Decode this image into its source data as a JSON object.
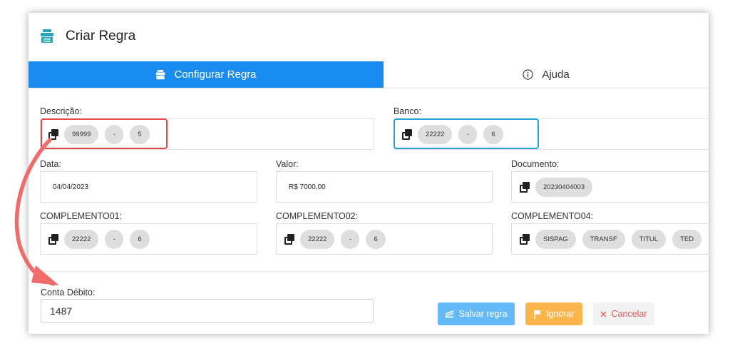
{
  "header": {
    "title": "Criar Regra"
  },
  "tabs": [
    {
      "label": "Configurar Regra",
      "active": true
    },
    {
      "label": "Ajuda",
      "active": false
    }
  ],
  "fields": {
    "descricao": {
      "label": "Descrição:",
      "chips": [
        "99999",
        "-",
        "5"
      ]
    },
    "banco": {
      "label": "Banco:",
      "chips": [
        "22222",
        "-",
        "6"
      ]
    },
    "data": {
      "label": "Data:",
      "value": "04/04/2023"
    },
    "valor": {
      "label": "Valor:",
      "value": "R$ 7000,00"
    },
    "documento": {
      "label": "Documento:",
      "chips": [
        "20230404003"
      ]
    },
    "complemento01": {
      "label": "COMPLEMENTO01:",
      "chips": [
        "22222",
        "-",
        "6"
      ]
    },
    "complemento02": {
      "label": "COMPLEMENTO02:",
      "chips": [
        "22222",
        "-",
        "6"
      ]
    },
    "complemento04": {
      "label": "COMPLEMENTO04:",
      "chips": [
        "SISPAG",
        "TRANSF",
        "TITUL",
        "TED"
      ]
    }
  },
  "conta_debito": {
    "label": "Conta Débito:",
    "value": "1487"
  },
  "buttons": {
    "save": "Salvar regra",
    "ignore": "Ignorar",
    "cancel": "Cancelar"
  },
  "colors": {
    "tab_active": "#1a8cf0",
    "highlight_red": "#e24a4a",
    "highlight_blue": "#26a4d6",
    "arrow": "#f26b6b",
    "save": "#64baf9",
    "ignore": "#fbb54d",
    "cancel_text": "#e25a5a"
  }
}
